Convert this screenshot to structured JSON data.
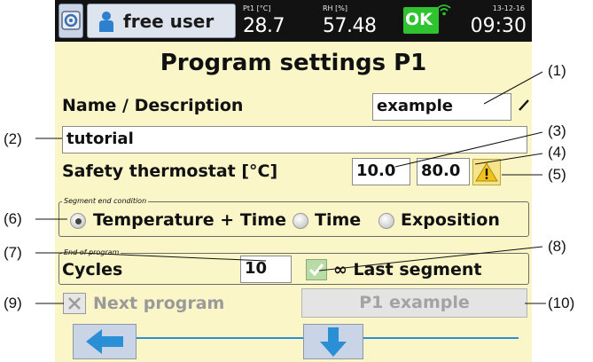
{
  "status_bar": {
    "user_label": "free user",
    "temp_label": "Pt1 [°C]",
    "temp_value": "28.7",
    "rh_label": "RH [%]",
    "rh_value": "57.48",
    "status_ok": "OK",
    "date": "13-12-16",
    "time": "09:30",
    "icons": [
      "app-menu-icon",
      "user-icon",
      "wifi-icon"
    ]
  },
  "title": "Program settings P1",
  "name_description": {
    "label": "Name / Description",
    "value": "example"
  },
  "description_value": "tutorial",
  "safety_thermostat": {
    "label": "Safety thermostat [°C]",
    "min": "10.0",
    "max": "80.0"
  },
  "segment_end": {
    "title": "Segment end condition",
    "options": [
      "Temperature + Time",
      "Time",
      "Exposition"
    ],
    "selected": "Temperature + Time"
  },
  "end_of_program": {
    "title": "End of program",
    "cycles_label": "Cycles",
    "cycles_value": "10",
    "last_segment_label": "∞ Last segment",
    "last_segment_checked": true,
    "next_program_label": "Next program",
    "next_program_checked": false,
    "next_program_button": "P1 example"
  },
  "callouts": [
    "(1)",
    "(2)",
    "(3)",
    "(4)",
    "(5)",
    "(6)",
    "(7)",
    "(8)",
    "(9)",
    "(10)"
  ],
  "colors": {
    "screen_bg": "#faf6c8",
    "status_bar": "#121212",
    "ok_green": "#2fc32f",
    "accent_blue": "#2b8fd6",
    "warning_yellow": "#f2c21b"
  }
}
